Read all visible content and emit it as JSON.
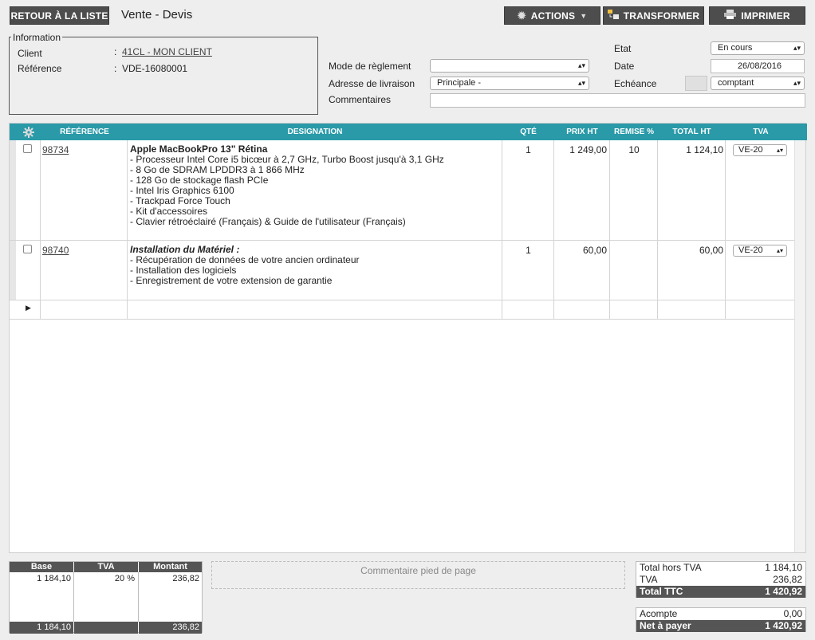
{
  "toolbar": {
    "back_label": "RETOUR À LA LISTE",
    "title": "Vente - Devis",
    "actions_label": "ACTIONS",
    "transform_label": "TRANSFORMER",
    "print_label": "IMPRIMER"
  },
  "information": {
    "legend": "Information",
    "client_label": "Client",
    "client_value": "41CL - MON CLIENT",
    "reference_label": "Référence",
    "reference_value": "VDE-16080001",
    "colon": ":"
  },
  "form": {
    "mode_reglement_label": "Mode de règlement",
    "mode_reglement_value": "",
    "adresse_label": "Adresse de livraison",
    "adresse_value": "Principale -",
    "commentaires_label": "Commentaires",
    "commentaires_value": "",
    "etat_label": "Etat",
    "etat_value": "En cours",
    "date_label": "Date",
    "date_value": "26/08/2016",
    "echeance_label": "Echéance",
    "echeance_value": "comptant"
  },
  "grid": {
    "headers": {
      "reference": "RÉFÉRENCE",
      "designation": "DESIGNATION",
      "qte": "QTÉ",
      "prix_ht": "PRIX HT",
      "remise": "REMISE %",
      "total_ht": "TOTAL HT",
      "tva": "TVA"
    },
    "rows": [
      {
        "reference": "98734",
        "title": "Apple MacBookPro 13\" Rétina",
        "lines": [
          "- Processeur Intel Core i5 bicœur à 2,7 GHz, Turbo Boost jusqu'à 3,1 GHz",
          "- 8 Go de SDRAM LPDDR3 à 1 866 MHz",
          "- 128 Go de stockage flash PCIe",
          "- Intel Iris Graphics 6100",
          "- Trackpad Force Touch",
          "- Kit d'accessoires",
          "- Clavier rétroéclairé (Français) & Guide de l'utilisateur (Français)"
        ],
        "qte": "1",
        "prix_ht": "1 249,00",
        "remise": "10",
        "total_ht": "1 124,10",
        "tva": "VE-20"
      },
      {
        "reference": "98740",
        "title": "Installation du Matériel :",
        "lines": [
          "- Récupération de données de votre ancien ordinateur",
          "- Installation des logiciels",
          "- Enregistrement de votre extension de garantie"
        ],
        "qte": "1",
        "prix_ht": "60,00",
        "remise": "",
        "total_ht": "60,00",
        "tva": "VE-20"
      }
    ]
  },
  "tva_summary": {
    "headers": {
      "base": "Base",
      "tva": "TVA",
      "montant": "Montant"
    },
    "row": {
      "base": "1 184,10",
      "tva": "20 %",
      "montant": "236,82"
    },
    "footer": {
      "base": "1 184,10",
      "montant": "236,82"
    }
  },
  "footer_comment_placeholder": "Commentaire pied de page",
  "totals": {
    "total_ht_label": "Total hors TVA",
    "total_ht_value": "1 184,10",
    "tva_label": "TVA",
    "tva_value": "236,82",
    "ttc_label": "Total TTC",
    "ttc_value": "1 420,92",
    "acompte_label": "Acompte",
    "acompte_value": "0,00",
    "net_label": "Net à payer",
    "net_value": "1 420,92"
  },
  "colors": {
    "header_teal": "#2a9aa8",
    "dark_button": "#4d4d4d",
    "dark_row": "#555555"
  }
}
